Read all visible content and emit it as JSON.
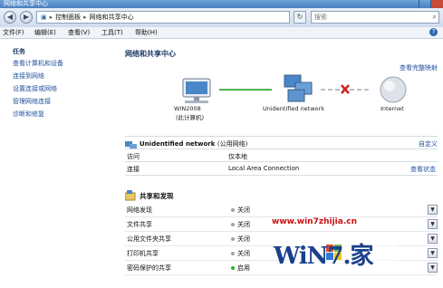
{
  "window": {
    "title": "网络和共享中心"
  },
  "address": {
    "segments": [
      "控制面板",
      "网络和共享中心"
    ],
    "search_placeholder": "搜索"
  },
  "menu": {
    "items": [
      "文件(F)",
      "编辑(E)",
      "查看(V)",
      "工具(T)",
      "帮助(H)"
    ]
  },
  "sidebar": {
    "heading": "任务",
    "links": [
      "查看计算机和设备",
      "连接到网络",
      "设置连接或网络",
      "管理网络连接",
      "诊断和修复"
    ]
  },
  "main": {
    "title": "网络和共享中心",
    "view_full_map": "查看完整映射",
    "map": {
      "computer": "WIN2008",
      "computer_sub": "(此计算机)",
      "network": "Unidentified network",
      "internet": "Internet"
    },
    "network": {
      "name": "Unidentified network",
      "type": "(公用网络)",
      "customize": "自定义",
      "access_label": "访问",
      "access_value": "仅本地",
      "connection_label": "连接",
      "connection_value": "Local Area Connection",
      "view_status": "查看状态"
    },
    "sharing": {
      "heading": "共享和发现",
      "rows": [
        {
          "label": "网络发现",
          "state": "关闭",
          "on": false
        },
        {
          "label": "文件共享",
          "state": "关闭",
          "on": false
        },
        {
          "label": "公用文件夹共享",
          "state": "关闭",
          "on": false
        },
        {
          "label": "打印机共享",
          "state": "关闭",
          "on": false
        },
        {
          "label": "密码保护的共享",
          "state": "启用",
          "on": true
        }
      ]
    }
  },
  "watermark": {
    "url": "www.win7zhijia.cn",
    "logo": "WiN7.家"
  },
  "colors": {
    "link": "#1f4f9c",
    "heading": "#1d3b6b",
    "status_on": "#2fae2f",
    "status_off": "#9aa3ad",
    "error_cross": "#d22020",
    "watermark": "#cc1010"
  }
}
